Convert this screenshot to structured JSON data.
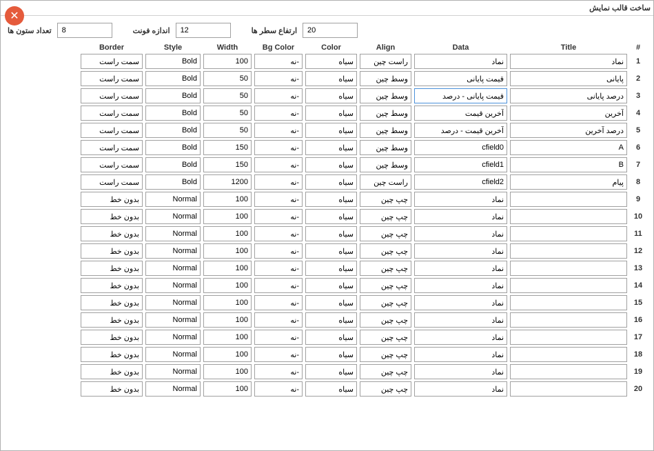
{
  "window": {
    "title": "ساخت قالب نمایش"
  },
  "top": {
    "columns_label": "تعداد ستون ها",
    "columns_value": "8",
    "fontsize_label": "اندازه فونت",
    "fontsize_value": "12",
    "rowheight_label": "ارتفاع سطر ها",
    "rowheight_value": "20"
  },
  "headers": {
    "num": "#",
    "title": "Title",
    "data": "Data",
    "align": "Align",
    "color": "Color",
    "bgcolor": "Bg Color",
    "width": "Width",
    "style": "Style",
    "border": "Border"
  },
  "rows": [
    {
      "num": "1",
      "title": "نماد",
      "data": "نماد",
      "align": "راست چین",
      "color": "سیاه",
      "bgcolor": "-نه",
      "width": "100",
      "style": "Bold",
      "border": "سمت راست",
      "active": false
    },
    {
      "num": "2",
      "title": "پایانی",
      "data": "قیمت پایانی",
      "align": "وسط چین",
      "color": "سیاه",
      "bgcolor": "-نه",
      "width": "50",
      "style": "Bold",
      "border": "سمت راست",
      "active": false
    },
    {
      "num": "3",
      "title": "درصد پایانی",
      "data": "قیمت پایانی - درصد",
      "align": "وسط چین",
      "color": "سیاه",
      "bgcolor": "-نه",
      "width": "50",
      "style": "Bold",
      "border": "سمت راست",
      "active": true
    },
    {
      "num": "4",
      "title": "آخرین",
      "data": "آخرین قیمت",
      "align": "وسط چین",
      "color": "سیاه",
      "bgcolor": "-نه",
      "width": "50",
      "style": "Bold",
      "border": "سمت راست",
      "active": false
    },
    {
      "num": "5",
      "title": "درصد آخرین",
      "data": "آخرین قیمت - درصد",
      "align": "وسط چین",
      "color": "سیاه",
      "bgcolor": "-نه",
      "width": "50",
      "style": "Bold",
      "border": "سمت راست",
      "active": false
    },
    {
      "num": "6",
      "title": "A",
      "data": "cfield0",
      "align": "وسط چین",
      "color": "سیاه",
      "bgcolor": "-نه",
      "width": "150",
      "style": "Bold",
      "border": "سمت راست",
      "active": false
    },
    {
      "num": "7",
      "title": "B",
      "data": "cfield1",
      "align": "وسط چین",
      "color": "سیاه",
      "bgcolor": "-نه",
      "width": "150",
      "style": "Bold",
      "border": "سمت راست",
      "active": false
    },
    {
      "num": "8",
      "title": "پیام",
      "data": "cfield2",
      "align": "راست چین",
      "color": "سیاه",
      "bgcolor": "-نه",
      "width": "1200",
      "style": "Bold",
      "border": "سمت راست",
      "active": false
    },
    {
      "num": "9",
      "title": "",
      "data": "نماد",
      "align": "چپ چین",
      "color": "سیاه",
      "bgcolor": "-نه",
      "width": "100",
      "style": "Normal",
      "border": "بدون خط",
      "active": false
    },
    {
      "num": "10",
      "title": "",
      "data": "نماد",
      "align": "چپ چین",
      "color": "سیاه",
      "bgcolor": "-نه",
      "width": "100",
      "style": "Normal",
      "border": "بدون خط",
      "active": false
    },
    {
      "num": "11",
      "title": "",
      "data": "نماد",
      "align": "چپ چین",
      "color": "سیاه",
      "bgcolor": "-نه",
      "width": "100",
      "style": "Normal",
      "border": "بدون خط",
      "active": false
    },
    {
      "num": "12",
      "title": "",
      "data": "نماد",
      "align": "چپ چین",
      "color": "سیاه",
      "bgcolor": "-نه",
      "width": "100",
      "style": "Normal",
      "border": "بدون خط",
      "active": false
    },
    {
      "num": "13",
      "title": "",
      "data": "نماد",
      "align": "چپ چین",
      "color": "سیاه",
      "bgcolor": "-نه",
      "width": "100",
      "style": "Normal",
      "border": "بدون خط",
      "active": false
    },
    {
      "num": "14",
      "title": "",
      "data": "نماد",
      "align": "چپ چین",
      "color": "سیاه",
      "bgcolor": "-نه",
      "width": "100",
      "style": "Normal",
      "border": "بدون خط",
      "active": false
    },
    {
      "num": "15",
      "title": "",
      "data": "نماد",
      "align": "چپ چین",
      "color": "سیاه",
      "bgcolor": "-نه",
      "width": "100",
      "style": "Normal",
      "border": "بدون خط",
      "active": false
    },
    {
      "num": "16",
      "title": "",
      "data": "نماد",
      "align": "چپ چین",
      "color": "سیاه",
      "bgcolor": "-نه",
      "width": "100",
      "style": "Normal",
      "border": "بدون خط",
      "active": false
    },
    {
      "num": "17",
      "title": "",
      "data": "نماد",
      "align": "چپ چین",
      "color": "سیاه",
      "bgcolor": "-نه",
      "width": "100",
      "style": "Normal",
      "border": "بدون خط",
      "active": false
    },
    {
      "num": "18",
      "title": "",
      "data": "نماد",
      "align": "چپ چین",
      "color": "سیاه",
      "bgcolor": "-نه",
      "width": "100",
      "style": "Normal",
      "border": "بدون خط",
      "active": false
    },
    {
      "num": "19",
      "title": "",
      "data": "نماد",
      "align": "چپ چین",
      "color": "سیاه",
      "bgcolor": "-نه",
      "width": "100",
      "style": "Normal",
      "border": "بدون خط",
      "active": false
    },
    {
      "num": "20",
      "title": "",
      "data": "نماد",
      "align": "چپ چین",
      "color": "سیاه",
      "bgcolor": "-نه",
      "width": "100",
      "style": "Normal",
      "border": "بدون خط",
      "active": false
    }
  ]
}
